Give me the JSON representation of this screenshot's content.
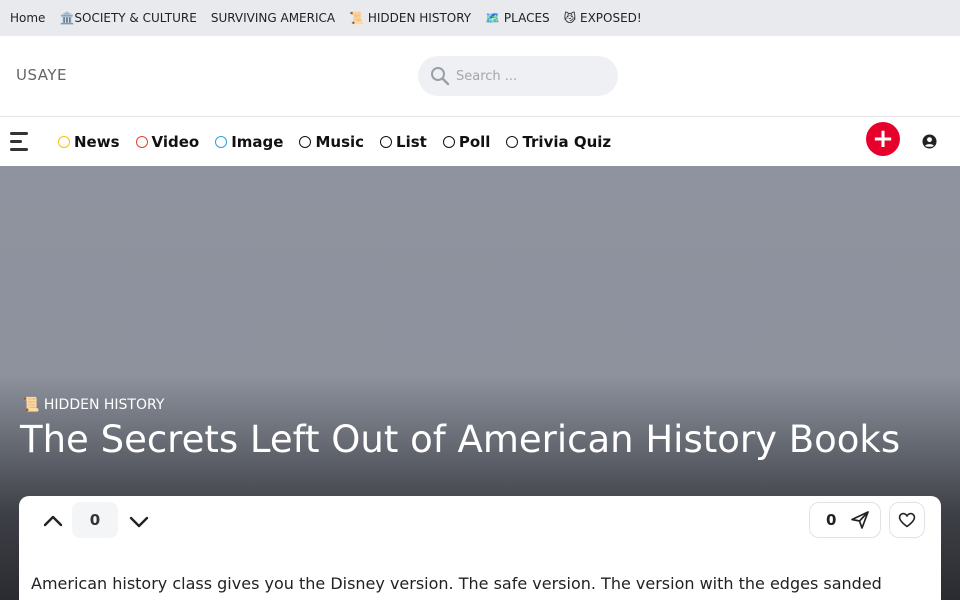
{
  "topbar": {
    "links": [
      {
        "label": "Home"
      },
      {
        "label": "🏛️SOCIETY & CULTURE"
      },
      {
        "label": "SURVIVING AMERICA"
      },
      {
        "label": "📜 HIDDEN HISTORY"
      },
      {
        "label": "🗺️ PLACES"
      },
      {
        "label": "😼 EXPOSED!"
      }
    ]
  },
  "header": {
    "logo": "USAYE",
    "search_placeholder": "Search ..."
  },
  "nav": {
    "items": [
      {
        "label": "News",
        "color": "#f5c400"
      },
      {
        "label": "Video",
        "color": "#e8412c"
      },
      {
        "label": "Image",
        "color": "#2aa3d8"
      },
      {
        "label": "Music",
        "color": "#111111"
      },
      {
        "label": "List",
        "color": "#111111"
      },
      {
        "label": "Poll",
        "color": "#111111"
      },
      {
        "label": "Trivia Quiz",
        "color": "#111111"
      }
    ],
    "create_symbol": "+",
    "accent": "#e8002c"
  },
  "hero": {
    "category": "📜 HIDDEN HISTORY",
    "title": "The Secrets Left Out of American History Books"
  },
  "article": {
    "vote_count": "0",
    "share_count": "0",
    "intro": "American history class gives you the Disney version. The safe version. The version with the edges sanded"
  },
  "icons": [
    "search-icon",
    "menu-icon",
    "plus-icon",
    "user-icon",
    "chevron-up-icon",
    "chevron-down-icon",
    "send-icon",
    "heart-icon"
  ]
}
